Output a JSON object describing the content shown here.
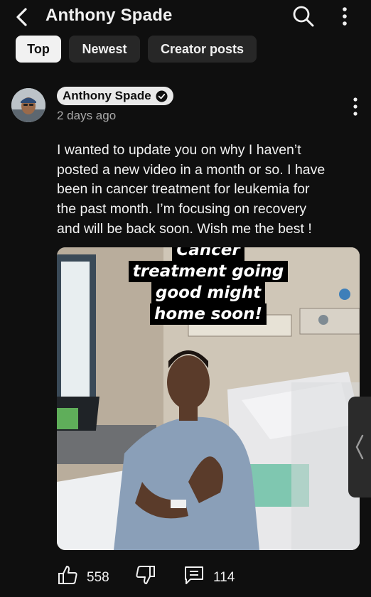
{
  "header": {
    "title": "Anthony Spade",
    "back_icon": "chevron-left-icon",
    "search_icon": "search-icon",
    "menu_icon": "more-vert-icon"
  },
  "tabs": [
    {
      "label": "Top",
      "active": true
    },
    {
      "label": "Newest",
      "active": false
    },
    {
      "label": "Creator posts",
      "active": false
    }
  ],
  "post": {
    "author": "Anthony Spade",
    "verified": true,
    "time": "2 days ago",
    "lines": [
      "I wanted to update you on why I haven’t",
      "posted a new video in a month or so. I have",
      "been in cancer treatment for leukemia for",
      "the past month. I’m focusing on recovery",
      "and will be back soon. Wish me the best !"
    ],
    "image_caption": [
      "Cancer",
      "treatment going",
      "good might",
      "home soon!"
    ],
    "likes": "558",
    "comments": "114"
  },
  "colors": {
    "background": "#0f0f0f",
    "chip": "#272727",
    "chip_active": "#f1f1f1",
    "text_secondary": "#aaaaaa"
  }
}
